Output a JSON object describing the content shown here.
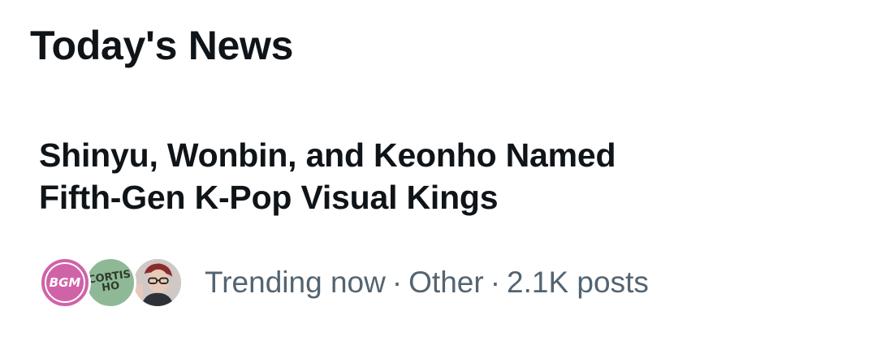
{
  "section": {
    "title": "Today's News"
  },
  "news_item": {
    "headline": "Shinyu, Wonbin, and Keonho Named Fifth-Gen K-Pop Visual Kings",
    "avatars": [
      {
        "label": "BGM",
        "color": "#d063a8"
      },
      {
        "label": "CORTIS HO",
        "color": "#8fb996"
      },
      {
        "label": "",
        "color": "#c9c2bf"
      }
    ],
    "meta": {
      "status": "Trending now",
      "separator": "·",
      "category": "Other",
      "posts": "2.1K posts"
    }
  },
  "colors": {
    "text_primary": "#0f1419",
    "text_secondary": "#536471",
    "background": "#ffffff"
  }
}
